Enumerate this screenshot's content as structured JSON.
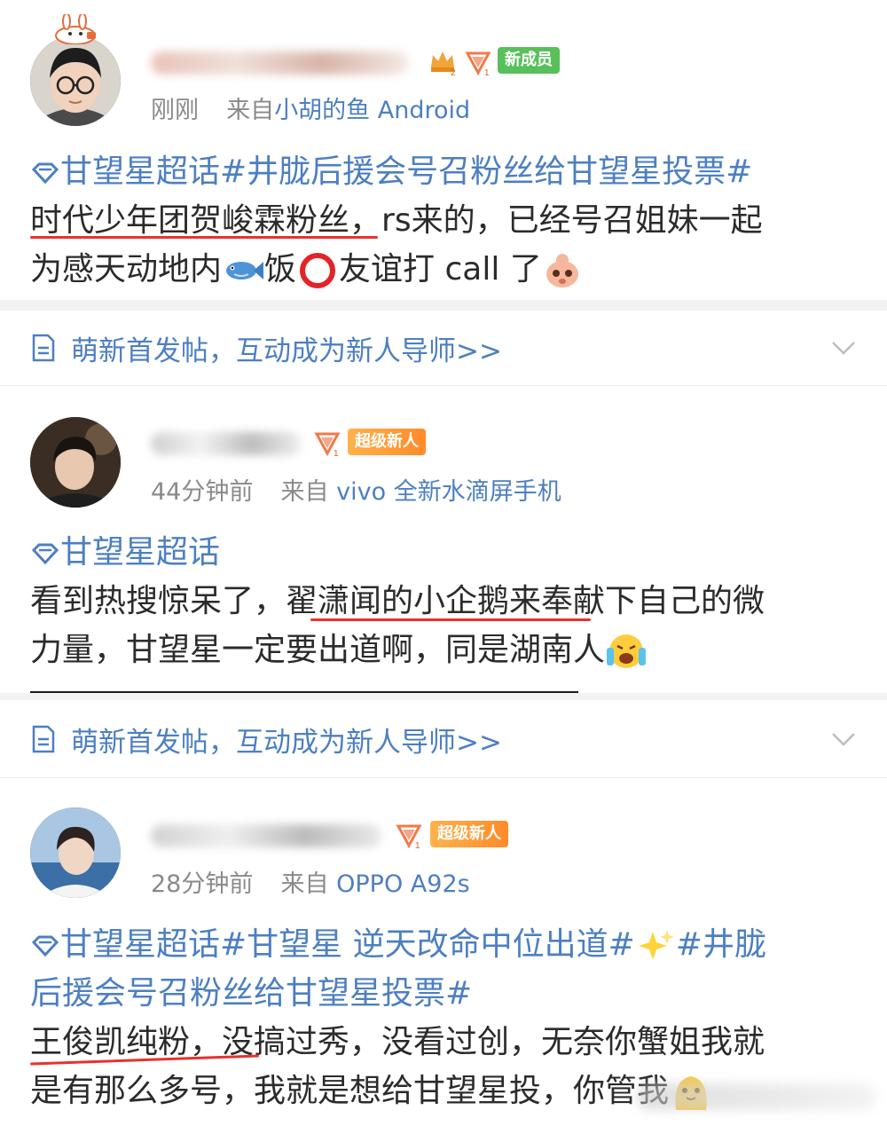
{
  "posts": [
    {
      "time": "刚刚",
      "from_prefix": "来自",
      "from_source": "小胡的鱼 Android",
      "badge": "新成员",
      "topic": "甘望星超话#井胧后援会号召粉丝给甘望星投票#",
      "line1_a": "时代少年团贺峻霖粉丝",
      "line1_b": "，rs来的，已经号召姐妹一起",
      "line2_a": "为感天动地内",
      "line2_b": "饭",
      "line2_c": "友谊打 call 了"
    },
    {
      "time": "44分钟前",
      "from_prefix": "来自",
      "from_source": "vivo 全新水滴屏手机",
      "badge": "超级新人",
      "topic": "甘望星超话",
      "line1": "看到热搜惊呆了，翟潇闻的小企鹅来奉献下自己的微",
      "line2": "力量，甘望星一定要出道啊，同是湖南人"
    },
    {
      "time": "28分钟前",
      "from_prefix": "来自",
      "from_source": "OPPO A92s",
      "badge": "超级新人",
      "topic_a": "甘望星超话#甘望星 逆天改命中位出道#",
      "topic_b": "#井胧",
      "topic_c": "后援会号召粉丝给甘望星投票#",
      "line1": "王俊凯纯粉，没搞过秀，没看过创，无奈你蟹姐我就",
      "line2": "是有那么多号，我就是想给甘望星投，你管我"
    }
  ],
  "banner": {
    "label": "萌新首发帖，互动成为新人导师>>"
  },
  "colors": {
    "link": "#4d7fc1",
    "meta": "#8a8a8a",
    "text": "#2b2b2b",
    "underline": "#e8312f",
    "badge_green": "#57c05a",
    "badge_orange": "#ff9a36"
  },
  "icons": [
    "diamond-topic-icon",
    "doc-icon",
    "chevron-down-icon",
    "fish-emoji-icon",
    "red-circle-icon",
    "cute-emoji-icon",
    "crying-emoji-icon",
    "sparkles-icon",
    "level-badge-icon",
    "crown-badge-icon"
  ]
}
